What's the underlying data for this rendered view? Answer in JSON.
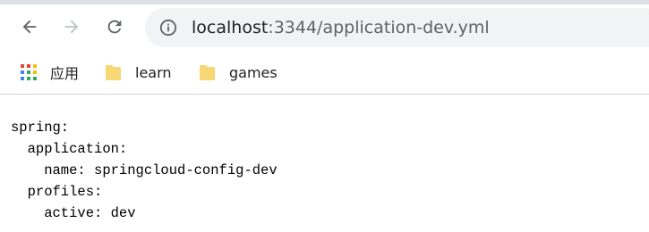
{
  "browser": {
    "url_host": "localhost",
    "url_rest": ":3344/application-dev.yml"
  },
  "bookmarks": {
    "apps_label": "应用",
    "items": [
      {
        "label": "learn",
        "icon": "folder-icon"
      },
      {
        "label": "games",
        "icon": "folder-icon"
      }
    ]
  },
  "page": {
    "yaml_text": "spring:\n  application:\n    name: springcloud-config-dev\n  profiles:\n    active: dev"
  },
  "colors": {
    "omnibox_bg": "#f1f3f4",
    "folder_yellow": "#f8d775",
    "icon_gray": "#5f6368"
  }
}
